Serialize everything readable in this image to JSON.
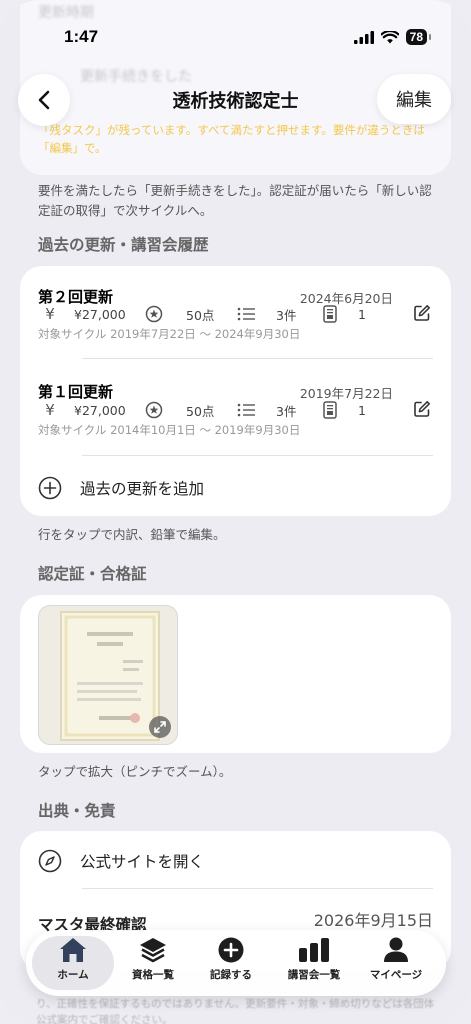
{
  "status": {
    "time": "1:47",
    "battery": "78"
  },
  "ghost": {
    "section": "更新時期",
    "row": "更新手続きをした"
  },
  "header": {
    "title": "透析技術認定士",
    "edit_label": "編集"
  },
  "warning": {
    "text": "「残タスク」が残っています。すべて満たすと押せます。要件が違うときは「編集」で。"
  },
  "note_top": {
    "text": "要件を満たしたら「更新手続きをした」。認定証が届いたら「新しい認定証の取得」で次サイクルへ。"
  },
  "history": {
    "section_title": "過去の更新・講習会履歴",
    "records": [
      {
        "title": "第２回更新",
        "date": "2024年6月20日",
        "fee": "¥27,000",
        "points": "50点",
        "items": "3件",
        "docs": "1",
        "cycle": "対象サイクル 2019年7月22日 〜 2024年9月30日"
      },
      {
        "title": "第１回更新",
        "date": "2019年7月22日",
        "fee": "¥27,000",
        "points": "50点",
        "items": "3件",
        "docs": "1",
        "cycle": "対象サイクル 2014年10月1日 〜 2019年9月30日"
      }
    ],
    "add_label": "過去の更新を追加",
    "footnote": "行をタップで内訳、鉛筆で編集。"
  },
  "certificate": {
    "section_title": "認定証・合格証",
    "footnote": "タップで拡大（ピンチでズーム）。"
  },
  "source": {
    "section_title": "出典・免責",
    "open_site_label": "公式サイトを開く",
    "master_label": "マスタ最終確認",
    "master_date": "2026年9月15日"
  },
  "bottom_ghost": "り、正確性を保証するものではありません。更新要件・対象・締め切りなどは各団体公式案内でご確認ください。",
  "tabs": [
    {
      "label": "ホーム",
      "icon": "home-icon"
    },
    {
      "label": "資格一覧",
      "icon": "layers-icon"
    },
    {
      "label": "記録する",
      "icon": "plus-circle-icon"
    },
    {
      "label": "講習会一覧",
      "icon": "bar-chart-icon"
    },
    {
      "label": "マイページ",
      "icon": "person-icon"
    }
  ],
  "colors": {
    "accent": "#3a4a6a",
    "warning": "#f2c94c",
    "background": "#edecf2"
  }
}
